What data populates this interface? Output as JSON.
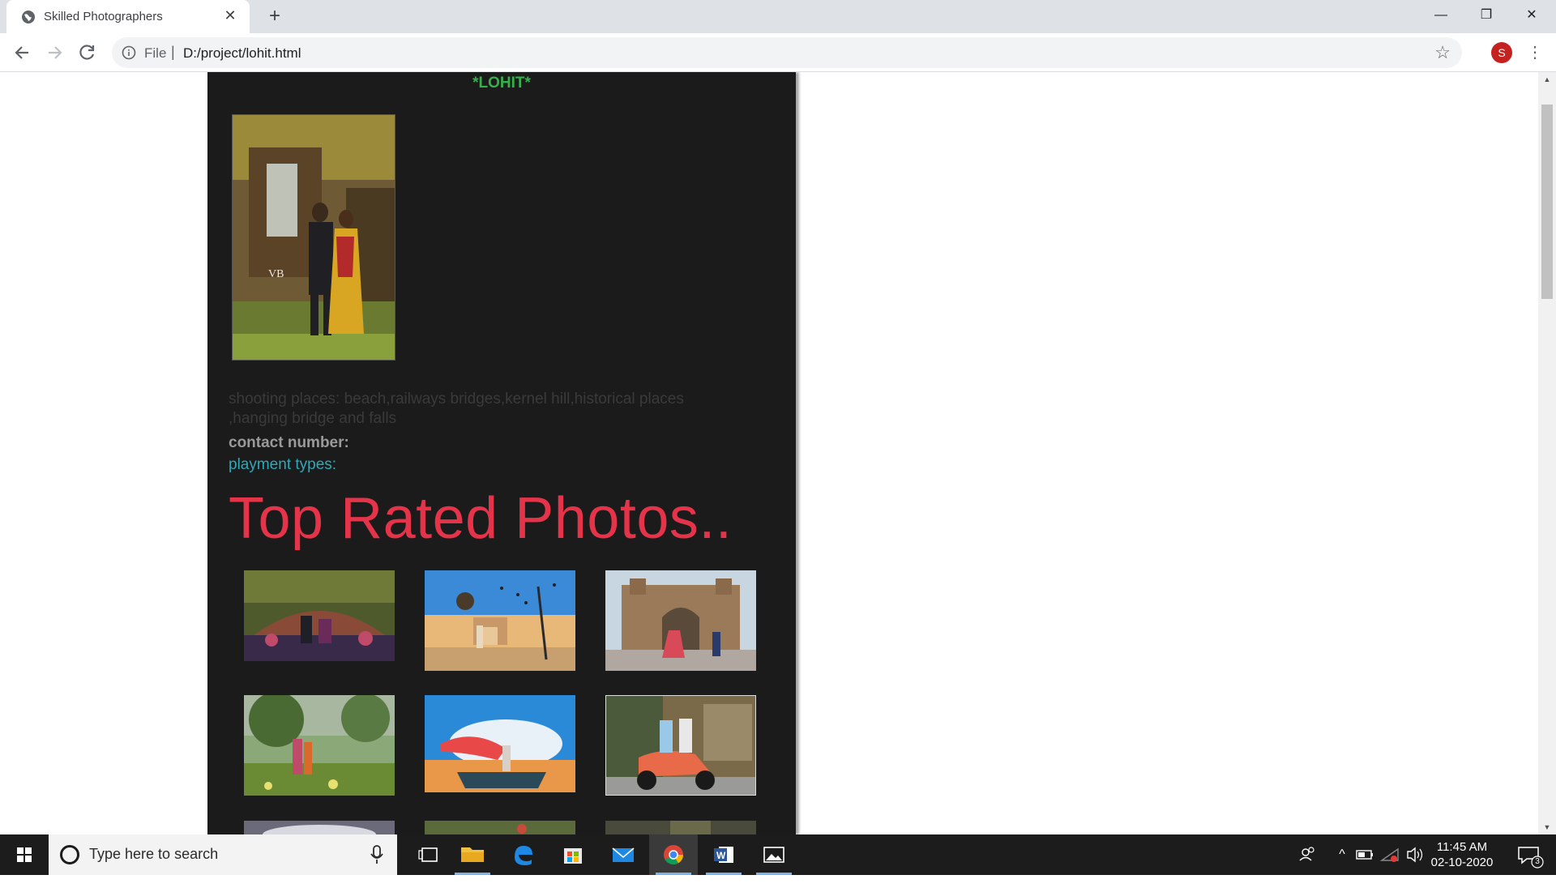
{
  "browser": {
    "tab_title": "Skilled Photographers",
    "tab_close": "✕",
    "new_tab": "+",
    "window_controls": {
      "minimize": "—",
      "maximize": "❐",
      "close": "✕"
    },
    "address_scheme": "File",
    "address_url": "D:/project/lohit.html",
    "profile_initial": "S",
    "menu_glyph": "⋮",
    "star_glyph": "☆"
  },
  "page": {
    "brand": "*LOHIT*",
    "shooting_places": "shooting places: beach,railways bridges,kernel hill,historical places ,hanging bridge and falls",
    "contact_label": "contact number:",
    "payment_label": "playment types:",
    "section_heading": "Top Rated Photos.."
  },
  "taskbar": {
    "search_placeholder": "Type here to search",
    "time": "11:45 AM",
    "date": "02-10-2020",
    "notifications": "3"
  }
}
